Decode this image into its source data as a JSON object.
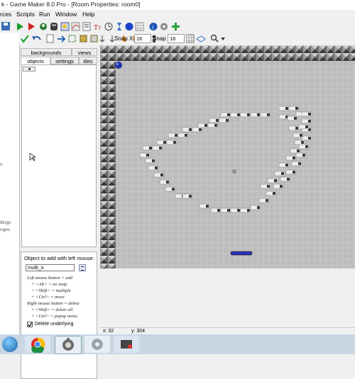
{
  "window": {
    "title": "k - Game Maker 8.0 Pro - [Room Properties: room0]"
  },
  "menu": [
    "rces",
    "Scripts",
    "Run",
    "Window",
    "Help"
  ],
  "toolbar_snap": {
    "snap_x_label": "Snap X:",
    "snap_x_value": "16",
    "snap_y_label": "Snap Y:",
    "snap_y_value": "16"
  },
  "left_strip": [
    "n",
    "ttings",
    "nges"
  ],
  "tabs": {
    "backgrounds": "backgrounds",
    "views": "views",
    "objects": "objects",
    "settings": "settings",
    "tiles": "tiles"
  },
  "object_box": {
    "label": "Object to add with left mouse:",
    "value": "multi_o",
    "help": [
      "Left mouse button = add",
      "+ <Alt> = no snap",
      "+ <Shift> = multiple",
      "+ <Ctrl> = move",
      "Right mouse button = delete",
      "+ <Shift> = delete all",
      "+ <Ctrl> = popup menu"
    ],
    "delete_underlying_label": "Delete underlying",
    "delete_underlying_checked": true
  },
  "status": {
    "x": "x: 32",
    "y": "y: 304"
  },
  "colors": {
    "room_bg": "#bcbcbc",
    "grid": "#d4d4d4",
    "wall_dark": "#3a3a3a",
    "wall_light": "#cfcfcf",
    "brick": "#ededed",
    "brick_shade": "#7a7a7a",
    "ball": "#1f2fa8",
    "paddle": "#2a34b8"
  },
  "icons": [
    "save-icon",
    "play-icon",
    "debug-icon",
    "sprite-icon",
    "sound-icon",
    "background-icon",
    "path-icon",
    "script-icon",
    "font-icon",
    "timeline-icon",
    "object-icon",
    "room-icon",
    "game-info-icon",
    "settings-icon",
    "extension-icon"
  ]
}
